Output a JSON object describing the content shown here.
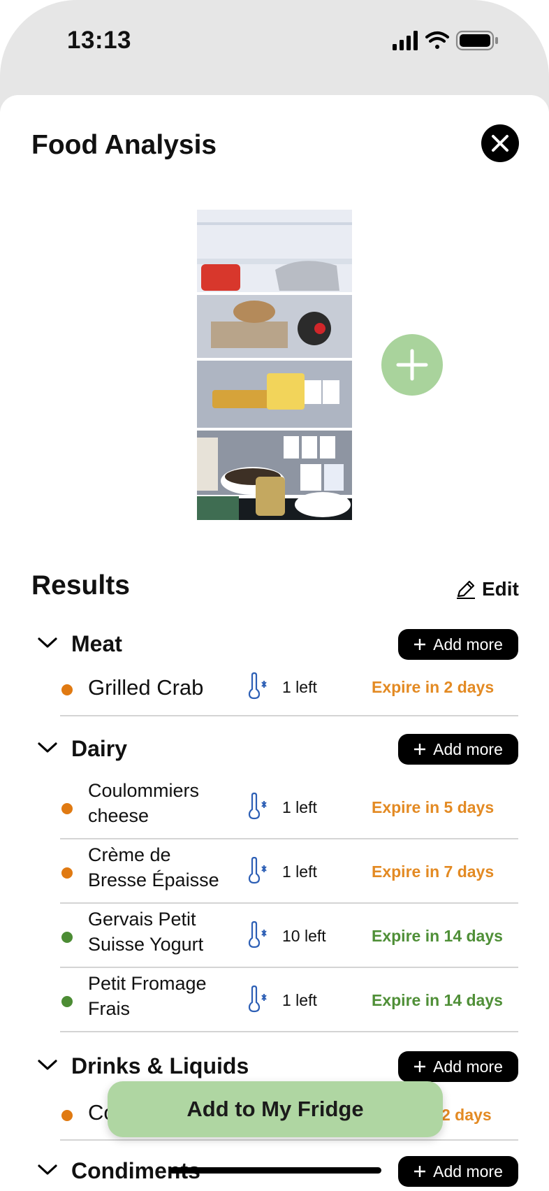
{
  "status_bar": {
    "time": "13:13",
    "icons": [
      "cellular-signal-icon",
      "wifi-icon",
      "battery-icon"
    ]
  },
  "header": {
    "title": "Food Analysis",
    "close_icon": "close-icon"
  },
  "photo": {
    "add_photo_icon": "plus-icon"
  },
  "results": {
    "title": "Results",
    "edit_label": "Edit",
    "edit_icon": "pencil-icon",
    "add_more_label": "Add more",
    "categories": [
      {
        "name": "Meat",
        "items": [
          {
            "name": "Grilled Crab",
            "qty": "1 left",
            "expiry": "Expire in 2 days",
            "status": "orange"
          }
        ]
      },
      {
        "name": "Dairy",
        "items": [
          {
            "name_lines": [
              "Coulommiers",
              "cheese"
            ],
            "qty": "1 left",
            "expiry": "Expire in 5 days",
            "status": "orange"
          },
          {
            "name_lines": [
              "Crème de",
              "Bresse Épaisse"
            ],
            "qty": "1 left",
            "expiry": "Expire in 7 days",
            "status": "orange"
          },
          {
            "name_lines": [
              "Gervais Petit",
              "Suisse Yogurt"
            ],
            "qty": "10 left",
            "expiry": "Expire in 14 days",
            "status": "green"
          },
          {
            "name_lines": [
              "Petit Fromage",
              "Frais"
            ],
            "qty": "1 left",
            "expiry": "Expire in 14 days",
            "status": "green"
          }
        ]
      },
      {
        "name": "Drinks & Liquids",
        "items": [
          {
            "name": "Co",
            "qty": "",
            "expiry": "2 days",
            "status": "orange"
          }
        ]
      },
      {
        "name": "Condiments",
        "items": []
      }
    ]
  },
  "cta": {
    "label": "Add to My Fridge"
  },
  "colors": {
    "accent_green": "#afd6a2",
    "expiry_orange": "#e38a23",
    "expiry_green": "#4f8f37"
  }
}
